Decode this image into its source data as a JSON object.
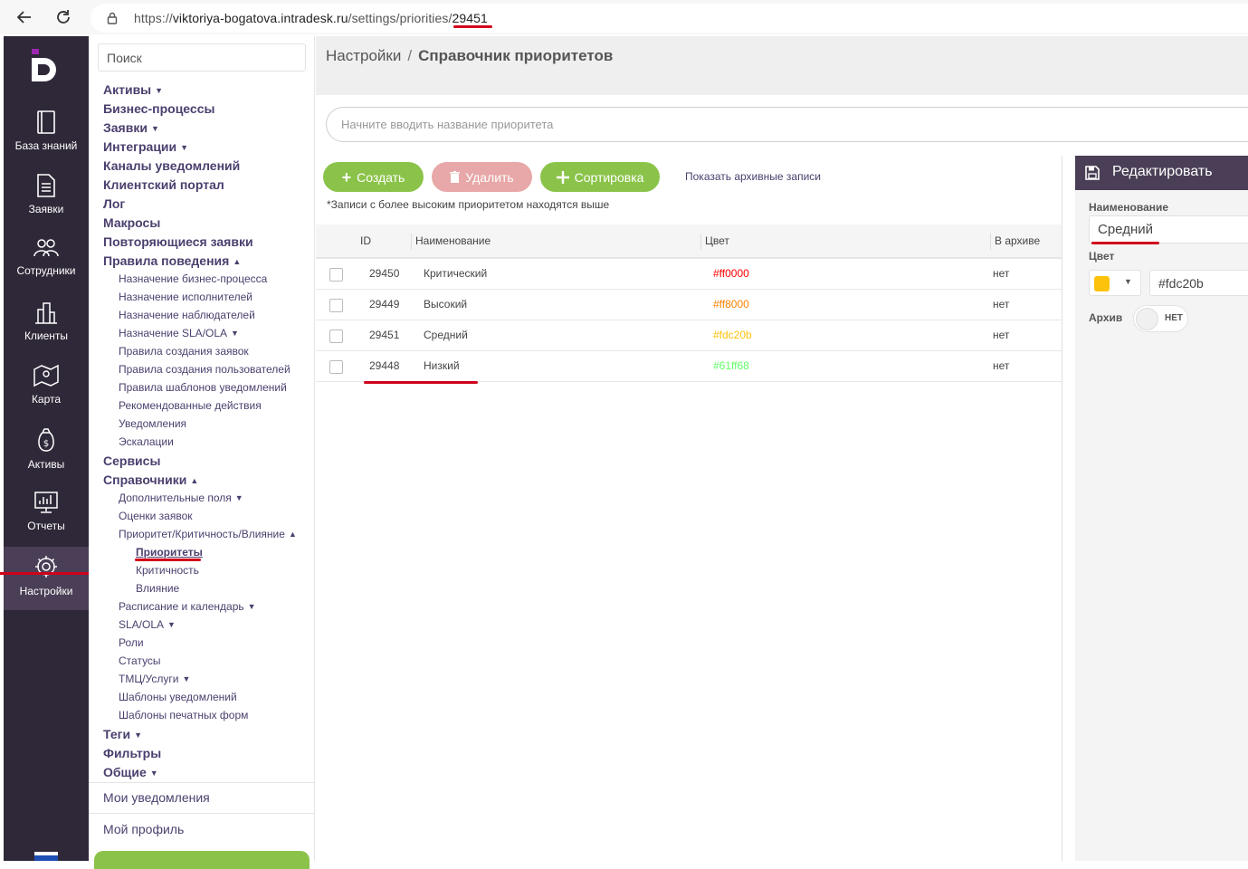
{
  "browser": {
    "url_scheme": "https://",
    "url_domain": "viktoriya-bogatova.intradesk.ru",
    "url_path": "/settings/priorities/",
    "url_id": "29451"
  },
  "sidebar": {
    "items": [
      {
        "label": "База знаний",
        "icon": "book-icon"
      },
      {
        "label": "Заявки",
        "icon": "document-icon"
      },
      {
        "label": "Сотрудники",
        "icon": "users-icon"
      },
      {
        "label": "Клиенты",
        "icon": "buildings-icon"
      },
      {
        "label": "Карта",
        "icon": "map-icon"
      },
      {
        "label": "Активы",
        "icon": "money-bag-icon"
      },
      {
        "label": "Отчеты",
        "icon": "chart-monitor-icon"
      },
      {
        "label": "Настройки",
        "icon": "gear-icon"
      }
    ]
  },
  "menu": {
    "search_placeholder": "Поиск",
    "items": [
      {
        "label": "Активы",
        "arrow": "▼"
      },
      {
        "label": "Бизнес-процессы",
        "arrow": ""
      },
      {
        "label": "Заявки",
        "arrow": "▼"
      },
      {
        "label": "Интеграции",
        "arrow": "▼"
      },
      {
        "label": "Каналы уведомлений",
        "arrow": ""
      },
      {
        "label": "Клиентский портал",
        "arrow": ""
      },
      {
        "label": "Лог",
        "arrow": ""
      },
      {
        "label": "Макросы",
        "arrow": ""
      },
      {
        "label": "Повторяющиеся заявки",
        "arrow": ""
      },
      {
        "label": "Правила поведения",
        "arrow": "▲"
      },
      {
        "label": "Назначение бизнес-процесса",
        "arrow": ""
      },
      {
        "label": "Назначение исполнителей",
        "arrow": ""
      },
      {
        "label": "Назначение наблюдателей",
        "arrow": ""
      },
      {
        "label": "Назначение SLA/OLA",
        "arrow": "▼"
      },
      {
        "label": "Правила создания заявок",
        "arrow": ""
      },
      {
        "label": "Правила создания пользователей",
        "arrow": ""
      },
      {
        "label": "Правила шаблонов уведомлений",
        "arrow": ""
      },
      {
        "label": "Рекомендованные действия",
        "arrow": ""
      },
      {
        "label": "Уведомления",
        "arrow": ""
      },
      {
        "label": "Эскалации",
        "arrow": ""
      },
      {
        "label": "Сервисы",
        "arrow": ""
      },
      {
        "label": "Справочники",
        "arrow": "▲"
      },
      {
        "label": "Дополнительные поля",
        "arrow": "▼"
      },
      {
        "label": "Оценки заявок",
        "arrow": ""
      },
      {
        "label": "Приоритет/Критичность/Влияние",
        "arrow": "▲"
      },
      {
        "label": "Приоритеты",
        "arrow": ""
      },
      {
        "label": "Критичность",
        "arrow": ""
      },
      {
        "label": "Влияние",
        "arrow": ""
      },
      {
        "label": "Расписание и календарь",
        "arrow": "▼"
      },
      {
        "label": "SLA/OLA",
        "arrow": "▼"
      },
      {
        "label": "Роли",
        "arrow": ""
      },
      {
        "label": "Статусы",
        "arrow": ""
      },
      {
        "label": "ТМЦ/Услуги",
        "arrow": "▼"
      },
      {
        "label": "Шаблоны уведомлений",
        "arrow": ""
      },
      {
        "label": "Шаблоны печатных форм",
        "arrow": ""
      },
      {
        "label": "Теги",
        "arrow": "▼"
      },
      {
        "label": "Фильтры",
        "arrow": ""
      },
      {
        "label": "Общие",
        "arrow": "▼"
      }
    ],
    "my_notifications": "Мои уведомления",
    "my_profile": "Мой профиль"
  },
  "header": {
    "crumb_root": "Настройки",
    "crumb_sep": "/",
    "crumb_current": "Справочник приоритетов"
  },
  "filter_placeholder": "Начните вводить название приоритета",
  "toolbar": {
    "create": "Создать",
    "delete": "Удалить",
    "sort": "Сортировка",
    "show_archive": "Показать архивные записи",
    "note": "*Записи с более высоким приоритетом находятся выше"
  },
  "table": {
    "columns": [
      "ID",
      "Наименование",
      "Цвет",
      "В архиве"
    ],
    "rows": [
      {
        "id": "29450",
        "name": "Критический",
        "color": "#ff0000",
        "archived": "нет"
      },
      {
        "id": "29449",
        "name": "Высокий",
        "color": "#ff8000",
        "archived": "нет"
      },
      {
        "id": "29451",
        "name": "Средний",
        "color": "#fdc20b",
        "archived": "нет"
      },
      {
        "id": "29448",
        "name": "Низкий",
        "color": "#61ff68",
        "archived": "нет"
      }
    ]
  },
  "edit": {
    "title": "Редактировать",
    "name_label": "Наименование",
    "name_value": "Средний",
    "color_label": "Цвет",
    "color_value": "#fdc20b",
    "archive_label": "Архив",
    "archive_toggle": "НЕТ"
  },
  "colors": {
    "accent": "#4a3f56",
    "green": "#8bc34a",
    "delete_disabled": "#e8a7a8",
    "highlight_mark": "#d0021b"
  }
}
